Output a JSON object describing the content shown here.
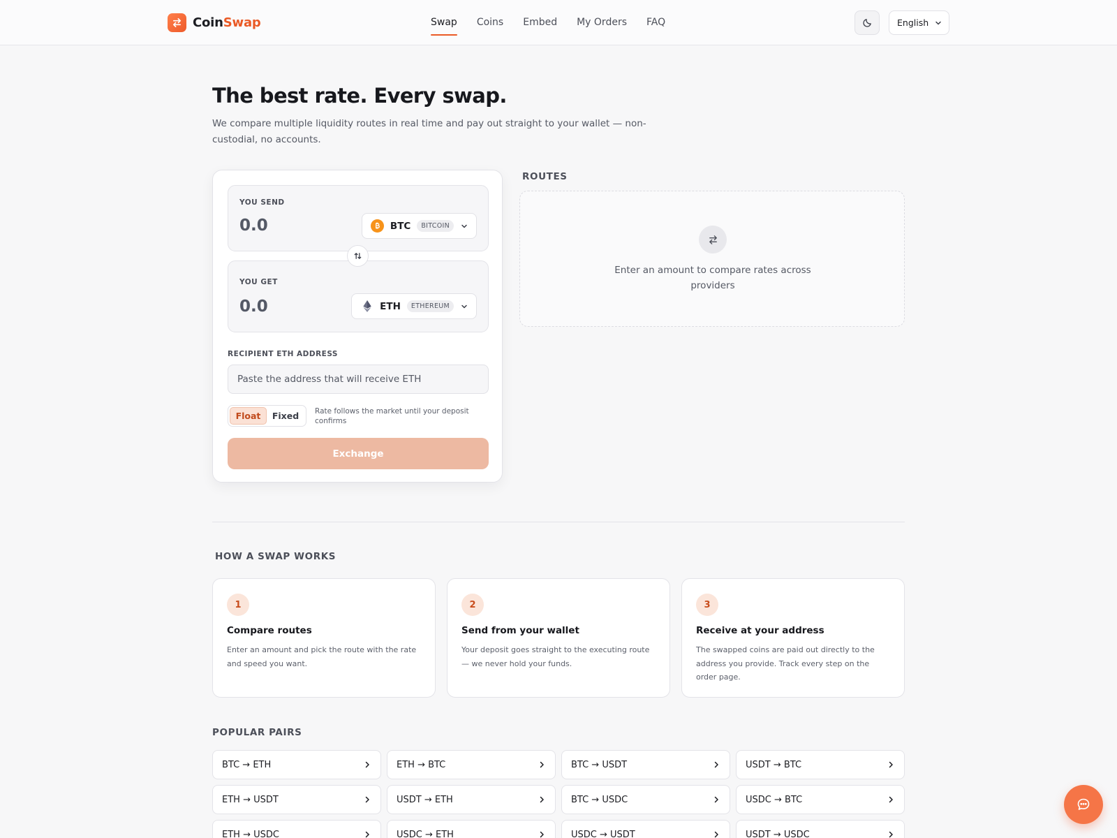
{
  "brand": {
    "name_part1": "Coin",
    "name_part2": "Swap",
    "accent_color": "#ea5a26"
  },
  "nav": [
    {
      "label": "Swap",
      "active": true
    },
    {
      "label": "Coins"
    },
    {
      "label": "Embed"
    },
    {
      "label": "My Orders"
    },
    {
      "label": "FAQ"
    }
  ],
  "header": {
    "theme_icon": "moon-icon",
    "language": "English"
  },
  "hero": {
    "title": "The best rate. Every swap.",
    "subtitle": "We compare multiple liquidity routes in real time and pay out straight to your wallet — non-custodial, no accounts."
  },
  "swap": {
    "send": {
      "label": "YOU SEND",
      "amount": "0.0",
      "ticker": "BTC",
      "network": "BITCOIN"
    },
    "get": {
      "label": "YOU GET",
      "amount": "0.0",
      "ticker": "ETH",
      "network": "ETHEREUM"
    },
    "recipient": {
      "label": "RECIPIENT ETH ADDRESS",
      "placeholder": "Paste the address that will receive ETH",
      "value": ""
    },
    "rate": {
      "float_label": "Float",
      "fixed_label": "Fixed",
      "selected": "Float",
      "note": "Rate follows the market until your deposit confirms"
    },
    "exchange_label": "Exchange"
  },
  "routes": {
    "title": "ROUTES",
    "empty_message": "Enter an amount to compare rates across providers"
  },
  "how": {
    "title": "HOW A SWAP WORKS",
    "steps": [
      {
        "num": "1",
        "title": "Compare routes",
        "desc": "Enter an amount and pick the route with the rate and speed you want."
      },
      {
        "num": "2",
        "title": "Send from your wallet",
        "desc": "Your deposit goes straight to the executing route — we never hold your funds."
      },
      {
        "num": "3",
        "title": "Receive at your address",
        "desc": "The swapped coins are paid out directly to the address you provide. Track every step on the order page."
      }
    ]
  },
  "pairs": {
    "title": "POPULAR PAIRS",
    "items": [
      "BTC → ETH",
      "ETH → BTC",
      "BTC → USDT",
      "USDT → BTC",
      "ETH → USDT",
      "USDT → ETH",
      "BTC → USDC",
      "USDC → BTC",
      "ETH → USDC",
      "USDC → ETH",
      "USDC → USDT",
      "USDT → USDC"
    ]
  }
}
